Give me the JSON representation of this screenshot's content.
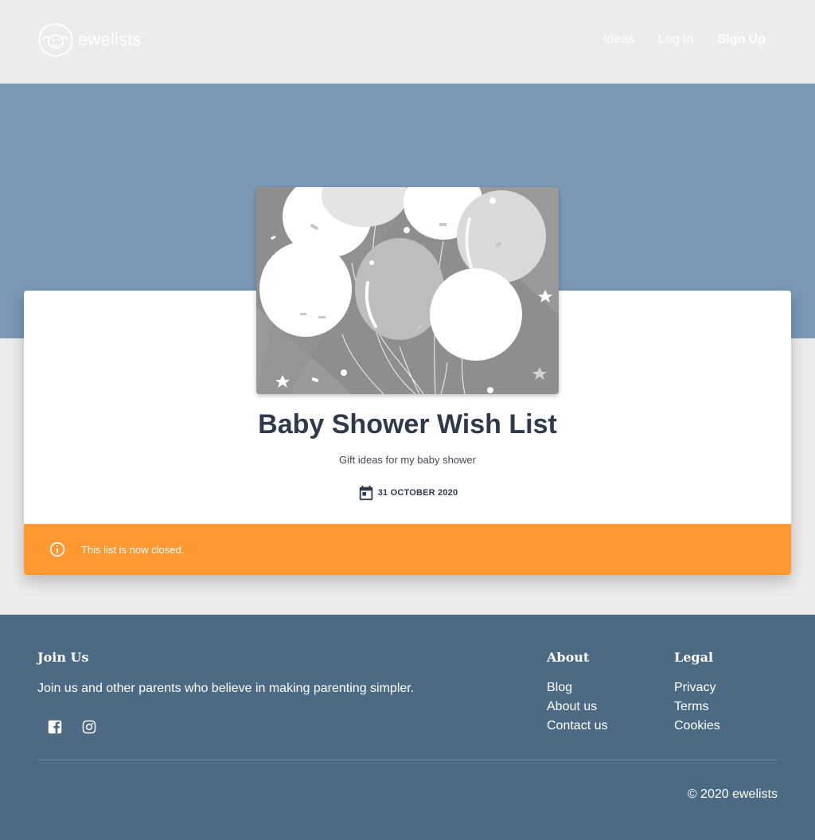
{
  "brand": {
    "name": "ewelists",
    "logo_icon": "sheep-icon"
  },
  "nav": {
    "ideas": "Ideas",
    "login": "Log In",
    "signup": "Sign Up"
  },
  "colors": {
    "hero": "#7999b7",
    "notice": "#ff9830",
    "footer": "#4d6a84",
    "title": "#2e3a4b"
  },
  "list": {
    "cover_image": "balloons-image",
    "title": "Baby Shower Wish List",
    "description": "Gift ideas for my baby shower",
    "date_icon": "calendar-icon",
    "date": "31 OCTOBER 2020",
    "notice_icon": "info-icon",
    "notice": "This list is now closed."
  },
  "footer": {
    "join": {
      "title": "Join Us",
      "text": "Join us and other parents who believe in making parenting simpler.",
      "social": [
        "facebook-icon",
        "instagram-icon"
      ]
    },
    "about": {
      "title": "About",
      "links": [
        "Blog",
        "About us",
        "Contact us"
      ]
    },
    "legal": {
      "title": "Legal",
      "links": [
        "Privacy",
        "Terms",
        "Cookies"
      ]
    },
    "copyright": "© 2020 ewelists"
  }
}
